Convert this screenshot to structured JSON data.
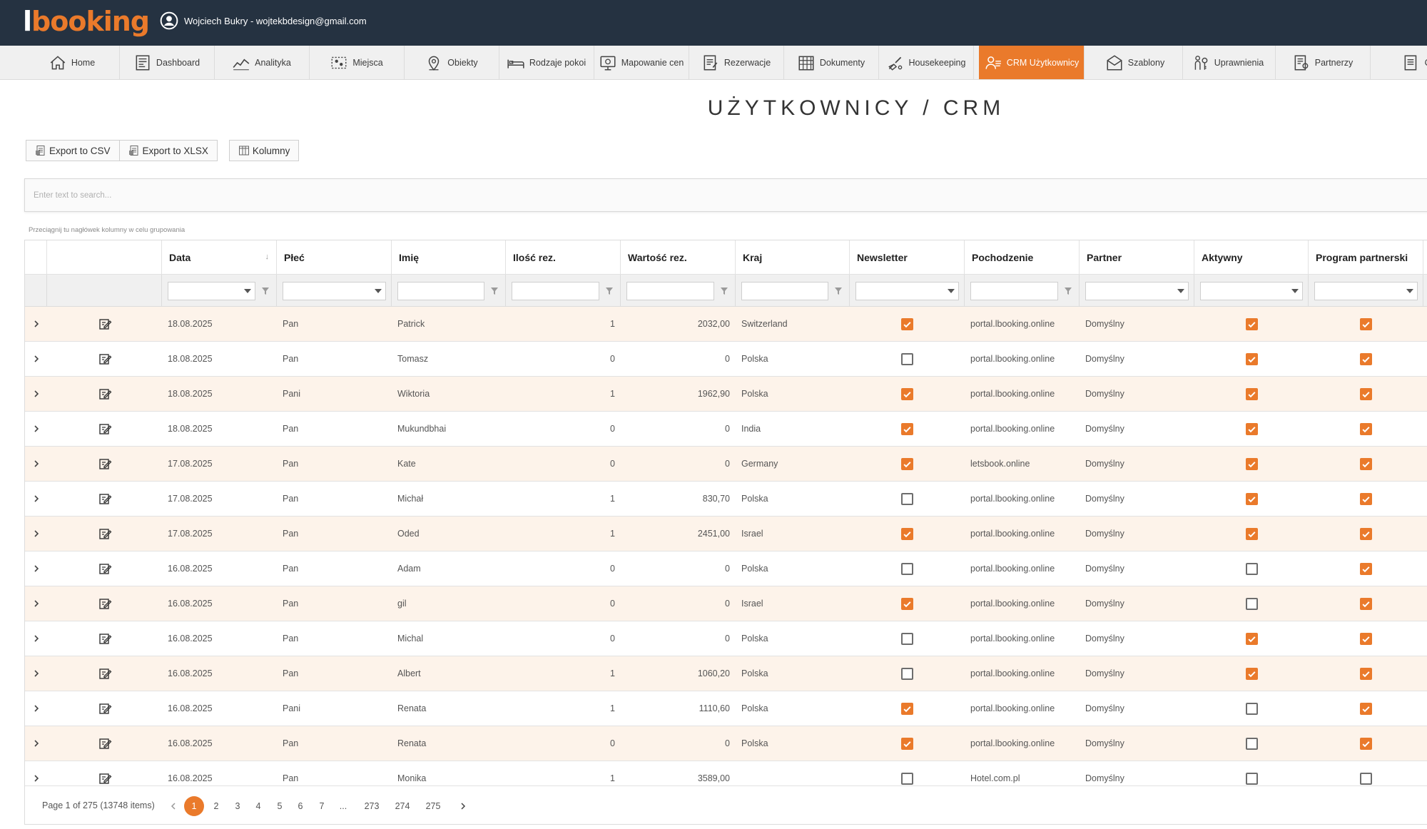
{
  "app": {
    "logo_prefix": "l",
    "logo_main": "booking",
    "user_label": "Wojciech Bukry - wojtekbdesign@gmail.com"
  },
  "nav": [
    {
      "label": "Home",
      "icon": "home-icon"
    },
    {
      "label": "Dashboard",
      "icon": "dashboard-icon"
    },
    {
      "label": "Analityka",
      "icon": "analytics-icon"
    },
    {
      "label": "Miejsca",
      "icon": "places-icon"
    },
    {
      "label": "Obiekty",
      "icon": "location-pin-icon"
    },
    {
      "label": "Rodzaje pokoi",
      "icon": "bed-icon"
    },
    {
      "label": "Mapowanie cen",
      "icon": "price-mapping-icon"
    },
    {
      "label": "Rezerwacje",
      "icon": "reservations-icon"
    },
    {
      "label": "Dokumenty",
      "icon": "documents-icon"
    },
    {
      "label": "Housekeeping",
      "icon": "housekeeping-icon"
    },
    {
      "label": "CRM Użytkownicy",
      "icon": "crm-users-icon",
      "active": true
    },
    {
      "label": "Szablony",
      "icon": "templates-icon"
    },
    {
      "label": "Uprawnienia",
      "icon": "permissions-icon"
    },
    {
      "label": "Partnerzy",
      "icon": "partners-icon"
    },
    {
      "label": "Cl",
      "icon": "more-icon"
    }
  ],
  "page": {
    "title": "UŻYTKOWNICY / CRM"
  },
  "toolbar": {
    "export_csv": "Export to CSV",
    "export_xlsx": "Export to XLSX",
    "columns": "Kolumny"
  },
  "search": {
    "placeholder": "Enter text to search..."
  },
  "grid": {
    "group_hint": "Przeciągnij tu nagłówek kolumny w celu grupowania",
    "columns": [
      "Data",
      "Płeć",
      "Imię",
      "Ilość rez.",
      "Wartość rez.",
      "Kraj",
      "Newsletter",
      "Pochodzenie",
      "Partner",
      "Aktywny",
      "Program partnerski"
    ],
    "rows": [
      {
        "date": "18.08.2025",
        "gender": "Pan",
        "name": "Patrick",
        "count": "1",
        "value": "2032,00",
        "country": "Switzerland",
        "newsletter": true,
        "origin": "portal.lbooking.online",
        "partner": "Domyślny",
        "active": true,
        "program": true
      },
      {
        "date": "18.08.2025",
        "gender": "Pan",
        "name": "Tomasz",
        "count": "0",
        "value": "0",
        "country": "Polska",
        "newsletter": false,
        "origin": "portal.lbooking.online",
        "partner": "Domyślny",
        "active": true,
        "program": true
      },
      {
        "date": "18.08.2025",
        "gender": "Pani",
        "name": "Wiktoria",
        "count": "1",
        "value": "1962,90",
        "country": "Polska",
        "newsletter": true,
        "origin": "portal.lbooking.online",
        "partner": "Domyślny",
        "active": true,
        "program": true
      },
      {
        "date": "18.08.2025",
        "gender": "Pan",
        "name": "Mukundbhai",
        "count": "0",
        "value": "0",
        "country": "India",
        "newsletter": true,
        "origin": "portal.lbooking.online",
        "partner": "Domyślny",
        "active": true,
        "program": true
      },
      {
        "date": "17.08.2025",
        "gender": "Pan",
        "name": "Kate",
        "count": "0",
        "value": "0",
        "country": "Germany",
        "newsletter": true,
        "origin": "letsbook.online",
        "partner": "Domyślny",
        "active": true,
        "program": true
      },
      {
        "date": "17.08.2025",
        "gender": "Pan",
        "name": "Michał",
        "count": "1",
        "value": "830,70",
        "country": "Polska",
        "newsletter": false,
        "origin": "portal.lbooking.online",
        "partner": "Domyślny",
        "active": true,
        "program": true
      },
      {
        "date": "17.08.2025",
        "gender": "Pan",
        "name": "Oded",
        "count": "1",
        "value": "2451,00",
        "country": "Israel",
        "newsletter": true,
        "origin": "portal.lbooking.online",
        "partner": "Domyślny",
        "active": true,
        "program": true
      },
      {
        "date": "16.08.2025",
        "gender": "Pan",
        "name": "Adam",
        "count": "0",
        "value": "0",
        "country": "Polska",
        "newsletter": false,
        "origin": "portal.lbooking.online",
        "partner": "Domyślny",
        "active": false,
        "program": true
      },
      {
        "date": "16.08.2025",
        "gender": "Pan",
        "name": "gil",
        "count": "0",
        "value": "0",
        "country": "Israel",
        "newsletter": true,
        "origin": "portal.lbooking.online",
        "partner": "Domyślny",
        "active": false,
        "program": true
      },
      {
        "date": "16.08.2025",
        "gender": "Pan",
        "name": "Michal",
        "count": "0",
        "value": "0",
        "country": "Polska",
        "newsletter": false,
        "origin": "portal.lbooking.online",
        "partner": "Domyślny",
        "active": true,
        "program": true
      },
      {
        "date": "16.08.2025",
        "gender": "Pan",
        "name": "Albert",
        "count": "1",
        "value": "1060,20",
        "country": "Polska",
        "newsletter": false,
        "origin": "portal.lbooking.online",
        "partner": "Domyślny",
        "active": true,
        "program": true
      },
      {
        "date": "16.08.2025",
        "gender": "Pani",
        "name": "Renata",
        "count": "1",
        "value": "1110,60",
        "country": "Polska",
        "newsletter": true,
        "origin": "portal.lbooking.online",
        "partner": "Domyślny",
        "active": false,
        "program": true
      },
      {
        "date": "16.08.2025",
        "gender": "Pan",
        "name": "Renata",
        "count": "0",
        "value": "0",
        "country": "Polska",
        "newsletter": true,
        "origin": "portal.lbooking.online",
        "partner": "Domyślny",
        "active": false,
        "program": true
      },
      {
        "date": "16.08.2025",
        "gender": "Pan",
        "name": "Monika",
        "count": "1",
        "value": "3589,00",
        "country": "",
        "newsletter": false,
        "origin": "Hotel.com.pl",
        "partner": "Domyślny",
        "active": false,
        "program": false
      }
    ]
  },
  "pager": {
    "info": "Page 1 of 275 (13748 items)",
    "pages": [
      "1",
      "2",
      "3",
      "4",
      "5",
      "6",
      "7",
      "...",
      "273",
      "274",
      "275"
    ],
    "current": "1"
  },
  "colors": {
    "accent": "#ea7a2b",
    "topbar": "#253241",
    "row_highlight": "#fdf3ea"
  }
}
